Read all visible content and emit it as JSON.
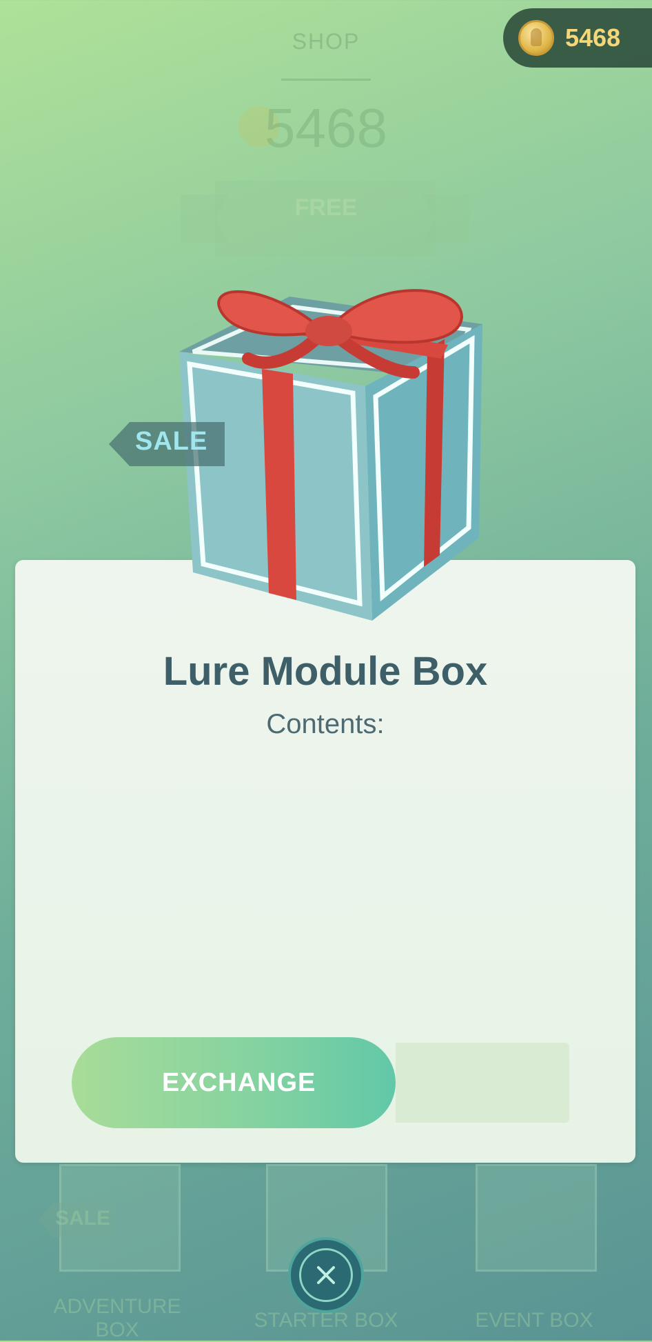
{
  "background_shop": {
    "title": "SHOP",
    "balance": "5468",
    "free_banner": "FREE",
    "bottom_items": [
      {
        "label": "ADVENTURE BOX",
        "tag": "SALE"
      },
      {
        "label": "STARTER BOX"
      },
      {
        "label": "EVENT BOX"
      }
    ]
  },
  "coin_balance": {
    "value": "5468",
    "icon": "pokecoin-icon"
  },
  "box": {
    "sale_tag": "SALE",
    "name": "Lure Module Box",
    "contents_label": "Contents:",
    "image": "gift-box-icon"
  },
  "actions": {
    "exchange_label": "EXCHANGE",
    "close_icon": "close-icon"
  },
  "colors": {
    "accent_green": "#86d3a0",
    "title_text": "#3e5f67",
    "coin_text": "#f4d77a",
    "sale_text": "#9fe6ee",
    "ribbon_red": "#d8483f",
    "box_teal": "#7fc2c7"
  }
}
